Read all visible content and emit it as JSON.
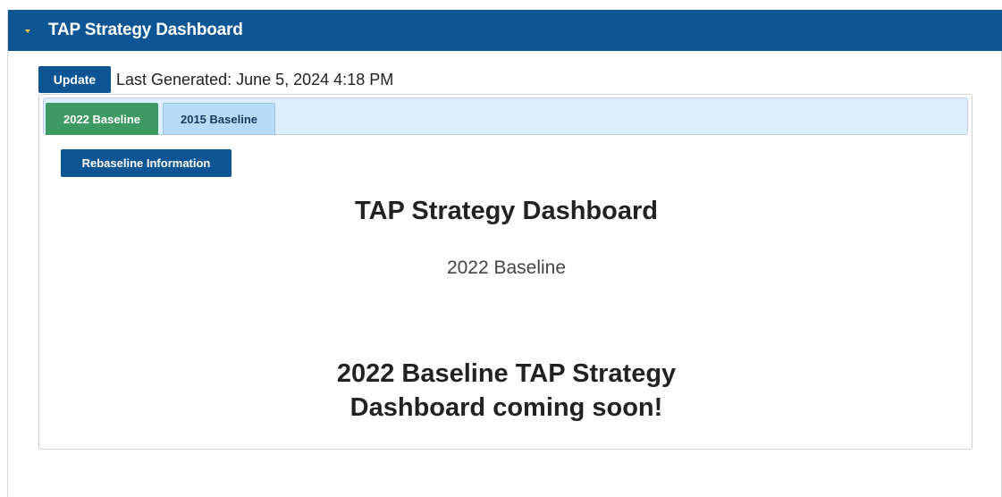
{
  "header": {
    "title": "TAP Strategy Dashboard",
    "toggle_icon": "caret-down-icon"
  },
  "toolbar": {
    "update_label": "Update",
    "last_generated": "Last Generated: June 5, 2024 4:18 PM"
  },
  "tabs": [
    {
      "label": "2022 Baseline",
      "active": true
    },
    {
      "label": "2015 Baseline",
      "active": false
    }
  ],
  "content": {
    "rebaseline_label": "Rebaseline Information",
    "title": "TAP Strategy Dashboard",
    "subtitle": "2022 Baseline",
    "message_line1": "2022 Baseline TAP Strategy",
    "message_line2": "Dashboard coming soon!"
  },
  "colors": {
    "primary": "#0d5593",
    "active_tab": "#3e9a63",
    "inactive_tab": "#b6daf7",
    "tabbar_bg": "#ddeeff",
    "caret": "#f0c14b"
  }
}
